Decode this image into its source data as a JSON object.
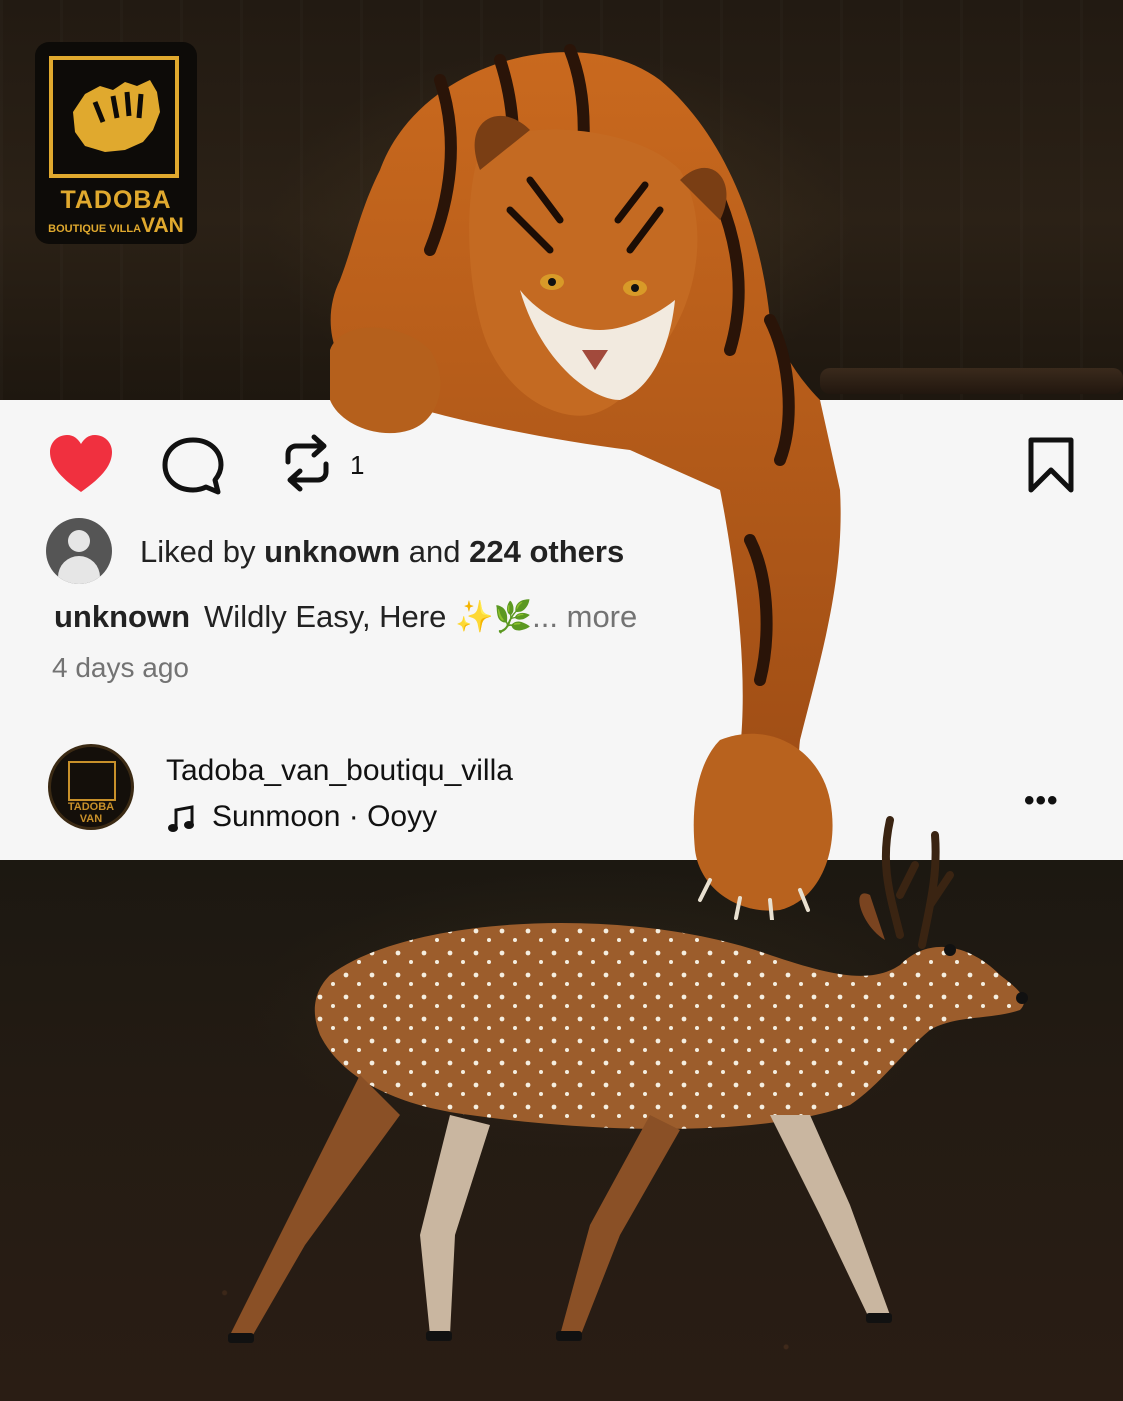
{
  "logo": {
    "title": "TADOBA",
    "sub_left": "BOUTIQUE VILLA",
    "sub_right": "VAN",
    "mini_title": "TADOBA",
    "mini_sub": "VAN"
  },
  "post": {
    "repost_count": "1",
    "likes": {
      "prefix": "Liked by",
      "user": "unknown",
      "middle": "and",
      "others": "224 others"
    },
    "caption": {
      "user": "unknown",
      "text": "Wildly Easy, Here ✨🌿",
      "more": "... more"
    },
    "time": "4 days ago",
    "account": {
      "name": "Tadoba_van_boutiqu_villa",
      "song": "Sunmoon · Ooyy",
      "menu": "•••"
    }
  },
  "icons": {
    "like": "heart-icon",
    "comment": "comment-icon",
    "repost": "repost-icon",
    "bookmark": "bookmark-icon",
    "music": "music-note-icon"
  },
  "colors": {
    "like_red": "#f0303f",
    "brand_gold": "#e0a92e",
    "card_bg": "#f6f6f6",
    "muted_text": "#737373"
  }
}
